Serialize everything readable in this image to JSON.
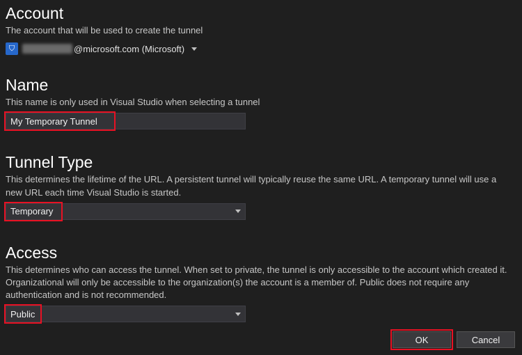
{
  "account": {
    "title": "Account",
    "desc": "The account that will be used to create the tunnel",
    "icon_glyph": "⛉",
    "email_suffix": "@microsoft.com (Microsoft)"
  },
  "name": {
    "title": "Name",
    "desc": "This name is only used in Visual Studio when selecting a tunnel",
    "value": "My Temporary Tunnel"
  },
  "tunnel_type": {
    "title": "Tunnel Type",
    "desc": "This determines the lifetime of the URL. A persistent tunnel will typically reuse the same URL. A temporary tunnel will use a new URL each time Visual Studio is started.",
    "value": "Temporary"
  },
  "access": {
    "title": "Access",
    "desc": "This determines who can access the tunnel. When set to private, the tunnel is only accessible to the account which created it. Organizational will only be accessible to the organization(s) the account is a member of. Public does not require any authentication and is not recommended.",
    "value": "Public"
  },
  "buttons": {
    "ok": "OK",
    "cancel": "Cancel"
  },
  "colors": {
    "highlight": "#e81123",
    "bg": "#1f1f1f",
    "input_bg": "#333337"
  }
}
